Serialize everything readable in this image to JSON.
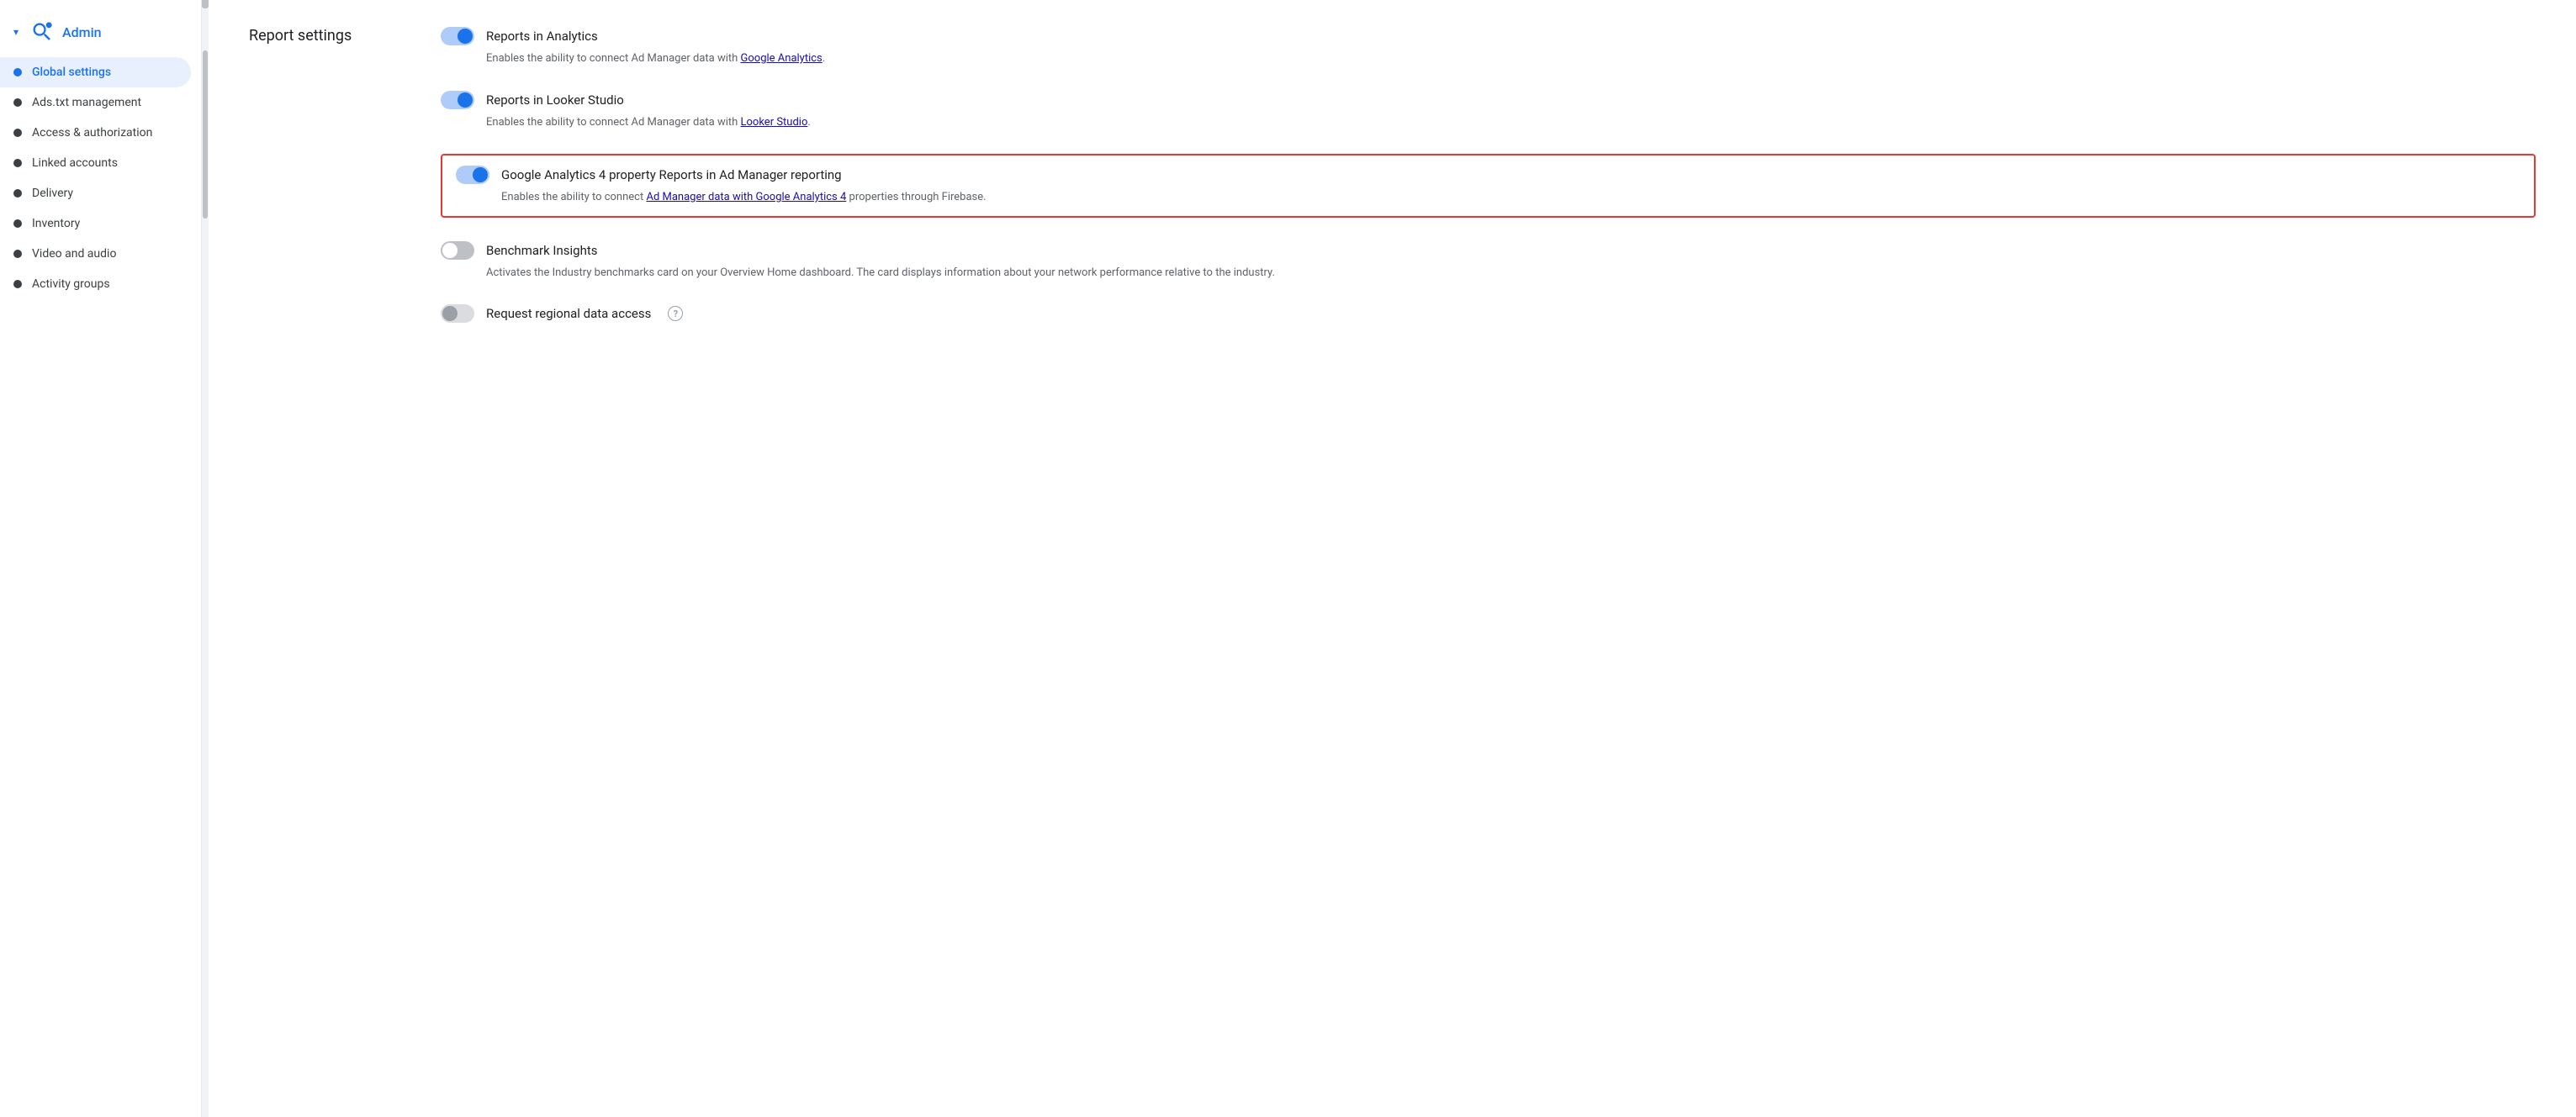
{
  "sidebar": {
    "header": {
      "title": "Admin",
      "icon": "wrench-search-icon"
    },
    "items": [
      {
        "id": "global-settings",
        "label": "Global settings",
        "active": true
      },
      {
        "id": "ads-txt",
        "label": "Ads.txt management",
        "active": false
      },
      {
        "id": "access-authorization",
        "label": "Access & authorization",
        "active": false
      },
      {
        "id": "linked-accounts",
        "label": "Linked accounts",
        "active": false
      },
      {
        "id": "delivery",
        "label": "Delivery",
        "active": false
      },
      {
        "id": "inventory",
        "label": "Inventory",
        "active": false
      },
      {
        "id": "video-audio",
        "label": "Video and audio",
        "active": false
      },
      {
        "id": "activity-groups",
        "label": "Activity groups",
        "active": false
      }
    ]
  },
  "main": {
    "section_title": "Report settings",
    "settings": [
      {
        "id": "reports-in-analytics",
        "label": "Reports in Analytics",
        "toggle_state": "on",
        "description": "Enables the ability to connect Ad Manager data with ",
        "link_text": "Google Analytics",
        "description_suffix": ".",
        "highlighted": false,
        "disabled": false
      },
      {
        "id": "reports-in-looker",
        "label": "Reports in Looker Studio",
        "toggle_state": "on",
        "description": "Enables the ability to connect Ad Manager data with ",
        "link_text": "Looker Studio",
        "description_suffix": ".",
        "highlighted": false,
        "disabled": false
      },
      {
        "id": "ga4-reports",
        "label": "Google Analytics 4 property Reports in Ad Manager reporting",
        "toggle_state": "on",
        "description": "Enables the ability to connect ",
        "link_text": "Ad Manager data with Google Analytics 4",
        "description_suffix": " properties through Firebase.",
        "highlighted": true,
        "disabled": false
      },
      {
        "id": "benchmark-insights",
        "label": "Benchmark Insights",
        "toggle_state": "off",
        "description": "Activates the Industry benchmarks card on your Overview Home dashboard. The card displays information about your network performance relative to the industry.",
        "link_text": "",
        "description_suffix": "",
        "highlighted": false,
        "disabled": false
      },
      {
        "id": "regional-data-access",
        "label": "Request regional data access",
        "toggle_state": "disabled",
        "description": "",
        "link_text": "",
        "description_suffix": "",
        "highlighted": false,
        "disabled": true,
        "has_info": true
      }
    ]
  }
}
